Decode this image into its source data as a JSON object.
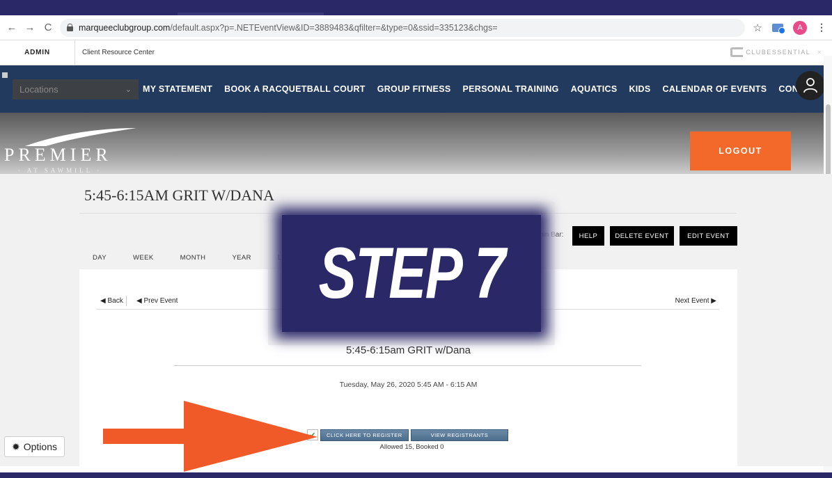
{
  "browser": {
    "back": "←",
    "forward": "→",
    "reload": "C",
    "url_host": "marqueeclubgroup.com",
    "url_path": "/default.aspx?p=.NETEventView&ID=3889483&qfilter=&type=0&ssid=335123&chgs=",
    "star": "☆",
    "profile_initial": "A",
    "menu": "⋮"
  },
  "admin_bar": {
    "admin_label": "ADMIN",
    "resource_label": "Client Resource Center",
    "brand": "CLUBESSENTIAL",
    "close": "×"
  },
  "nav": {
    "locations": "Locations",
    "links": [
      "MY STATEMENT",
      "BOOK A RACQUETBALL COURT",
      "GROUP FITNESS",
      "PERSONAL TRAINING",
      "AQUATICS",
      "KIDS",
      "CALENDAR OF EVENTS",
      "CONTACTS"
    ]
  },
  "header": {
    "logo_main": "PREMIER",
    "logo_sub": "· AT SAWMILL ·",
    "logout": "LOGOUT"
  },
  "event": {
    "title": "5:45-6:15AM GRIT W/DANA",
    "admin_bar_label": "Admin Bar:",
    "help": "HELP",
    "delete": "DELETE EVENT",
    "edit": "EDIT EVENT",
    "view_tabs": [
      "DAY",
      "WEEK",
      "MONTH",
      "YEAR",
      "LIST"
    ],
    "back": "◀ Back",
    "prev": "◀  Prev Event",
    "next": "Next Event ▶",
    "name": "5:45-6:15am GRIT w/Dana",
    "date": "Tuesday, May 26, 2020 5:45 AM - 6:15 AM",
    "register": "CLICK HERE TO REGISTER",
    "view_registrants": "VIEW REGISTRANTS",
    "allowed": "Allowed 15, Booked 0"
  },
  "options": "Options",
  "overlay": {
    "step": "STEP 7"
  },
  "colors": {
    "frame": "#2b2868",
    "nav": "#223a5e",
    "logout": "#f2692a",
    "arrow": "#f05a28"
  }
}
